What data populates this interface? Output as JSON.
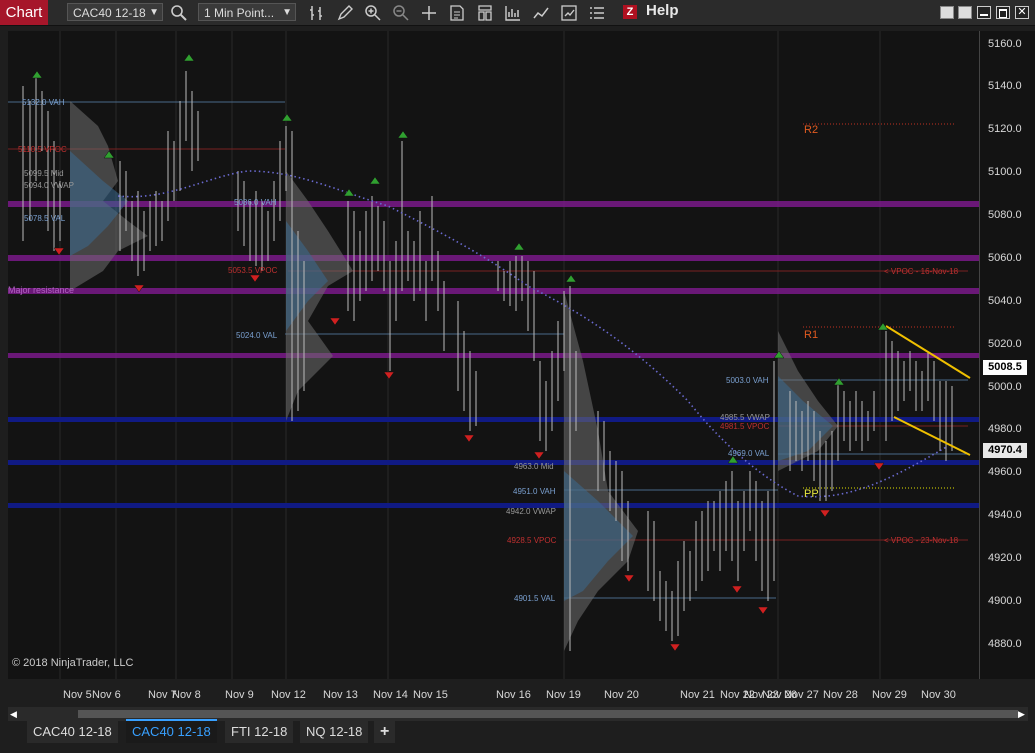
{
  "toolbar": {
    "chart_label": "Chart",
    "instrument": "CAC40 12-18",
    "interval": "1 Min Point...",
    "help": "Help",
    "z": "Z"
  },
  "price_axis": {
    "labels": [
      "5160.0",
      "5140.0",
      "5120.0",
      "5100.0",
      "5080.0",
      "5060.0",
      "5040.0",
      "5020.0",
      "5000.0",
      "4980.0",
      "4960.0",
      "4940.0",
      "4920.0",
      "4900.0",
      "4880.0"
    ],
    "current_price": "5008.5",
    "last_price": "4970.4"
  },
  "date_axis": {
    "labels": [
      "Nov 5",
      "Nov 6",
      "Nov 7",
      "Nov 8",
      "Nov 9",
      "Nov 12",
      "Nov 13",
      "Nov 14",
      "Nov 15",
      "Nov 16",
      "Nov 19",
      "Nov 20",
      "Nov 21",
      "Nov 22",
      "Nov 23",
      "Nov 26",
      "Nov 27",
      "Nov 28",
      "Nov 29",
      "Nov 30"
    ]
  },
  "levels": {
    "r2": "R2",
    "r1": "R1",
    "pp": "PP",
    "major_resistance": "Major resistance",
    "vpoc_16": "< VPOC - 16-Nov-18",
    "vpoc_23": "< VPOC - 23-Nov-18"
  },
  "profile_labels": {
    "vah_5132": "5132.0 VAH",
    "vpoc_5110": "5110.5 VPOC",
    "mid_5099": "5099.5 Mid",
    "vwap_5094": "5094.0 VWAP",
    "val_5078": "5078.5 VAL",
    "vah_5086": "5086.0 VAH",
    "vpoc_5053": "5053.5 VPOC",
    "val_5024": "5024.0 VAL",
    "mid_4963": "4963.0 Mid",
    "vah_4951": "4951.0 VAH",
    "vwap_4942": "4942.0 VWAP",
    "vpoc_4928": "4928.5 VPOC",
    "val_4901": "4901.5 VAL",
    "vah_5003": "5003.0 VAH",
    "vwap_4985": "4985.5 VWAP",
    "vpoc_4981": "4981.5 VPOC",
    "val_4969": "4969.0 VAL"
  },
  "copyright": "© 2018 NinjaTrader, LLC",
  "tabs": [
    "CAC40 12-18",
    "CAC40 12-18",
    "FTI 12-18",
    "NQ 12-18"
  ],
  "add_tab": "+",
  "colors": {
    "chart_bg": "#131313",
    "accent": "#a6162a",
    "resistance": "#8a1a9a",
    "support": "#1a2a9a",
    "vwap": "#6a6ad0",
    "trendline": "#f0c000"
  }
}
